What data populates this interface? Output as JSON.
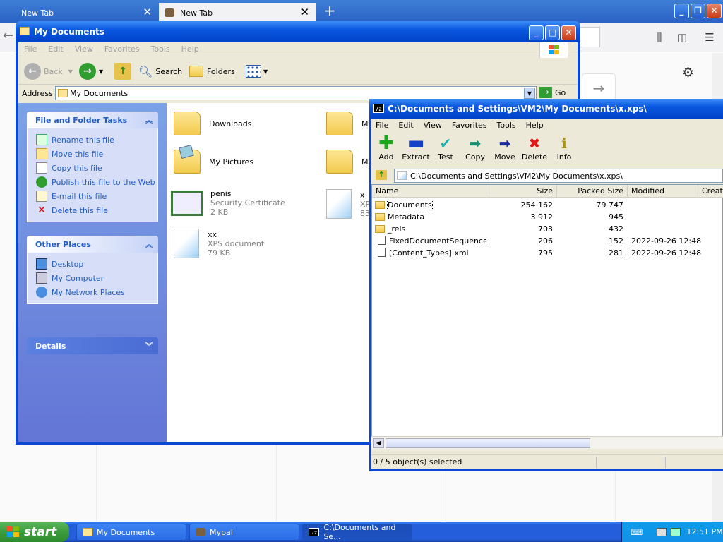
{
  "firefox": {
    "tabs": [
      {
        "label": "New Tab"
      },
      {
        "label": "New Tab"
      }
    ],
    "new_tab_glyph": "+"
  },
  "explorer": {
    "title": "My Documents",
    "menu": [
      "File",
      "Edit",
      "View",
      "Favorites",
      "Tools",
      "Help"
    ],
    "toolbar": {
      "back": "Back",
      "search": "Search",
      "folders": "Folders"
    },
    "address_label": "Address",
    "address_value": "My Documents",
    "go_label": "Go",
    "tasks_panel": {
      "title": "File and Folder Tasks",
      "items": [
        "Rename this file",
        "Move this file",
        "Copy this file",
        "Publish this file to the Web",
        "E-mail this file",
        "Delete this file"
      ]
    },
    "places_panel": {
      "title": "Other Places",
      "items": [
        "Desktop",
        "My Computer",
        "My Network Places"
      ]
    },
    "details_panel": {
      "title": "Details"
    },
    "files": [
      {
        "name": "Downloads"
      },
      {
        "name": "My Pictures"
      },
      {
        "name": "penis",
        "type": "Security Certificate",
        "size": "2 KB"
      },
      {
        "name": "xx",
        "type": "XPS document",
        "size": "79 KB"
      },
      {
        "name": "My"
      },
      {
        "name": "My"
      },
      {
        "name": "x",
        "type": "XP",
        "size": "83"
      }
    ]
  },
  "sevenzip": {
    "title": "C:\\Documents and Settings\\VM2\\My Documents\\x.xps\\",
    "badge": "7z",
    "menu": [
      "File",
      "Edit",
      "View",
      "Favorites",
      "Tools",
      "Help"
    ],
    "toolbar": [
      "Add",
      "Extract",
      "Test",
      "Copy",
      "Move",
      "Delete",
      "Info"
    ],
    "path": "C:\\Documents and Settings\\VM2\\My Documents\\x.xps\\",
    "columns": [
      "Name",
      "Size",
      "Packed Size",
      "Modified",
      "Create"
    ],
    "rows": [
      {
        "name": "Documents",
        "size": "254 162",
        "packed": "79 747",
        "modified": "",
        "kind": "folder"
      },
      {
        "name": "Metadata",
        "size": "3 912",
        "packed": "945",
        "modified": "",
        "kind": "folder"
      },
      {
        "name": "_rels",
        "size": "703",
        "packed": "432",
        "modified": "",
        "kind": "folder"
      },
      {
        "name": "FixedDocumentSequence…",
        "size": "206",
        "packed": "152",
        "modified": "2022-09-26 12:48",
        "kind": "file"
      },
      {
        "name": "[Content_Types].xml",
        "size": "795",
        "packed": "281",
        "modified": "2022-09-26 12:48",
        "kind": "file"
      }
    ],
    "status": "0 / 5 object(s) selected"
  },
  "taskbar": {
    "start_label": "start",
    "buttons": [
      {
        "label": "My Documents"
      },
      {
        "label": "Mypal"
      },
      {
        "label": "C:\\Documents and Se..."
      }
    ],
    "clock": "12:51 PM"
  }
}
